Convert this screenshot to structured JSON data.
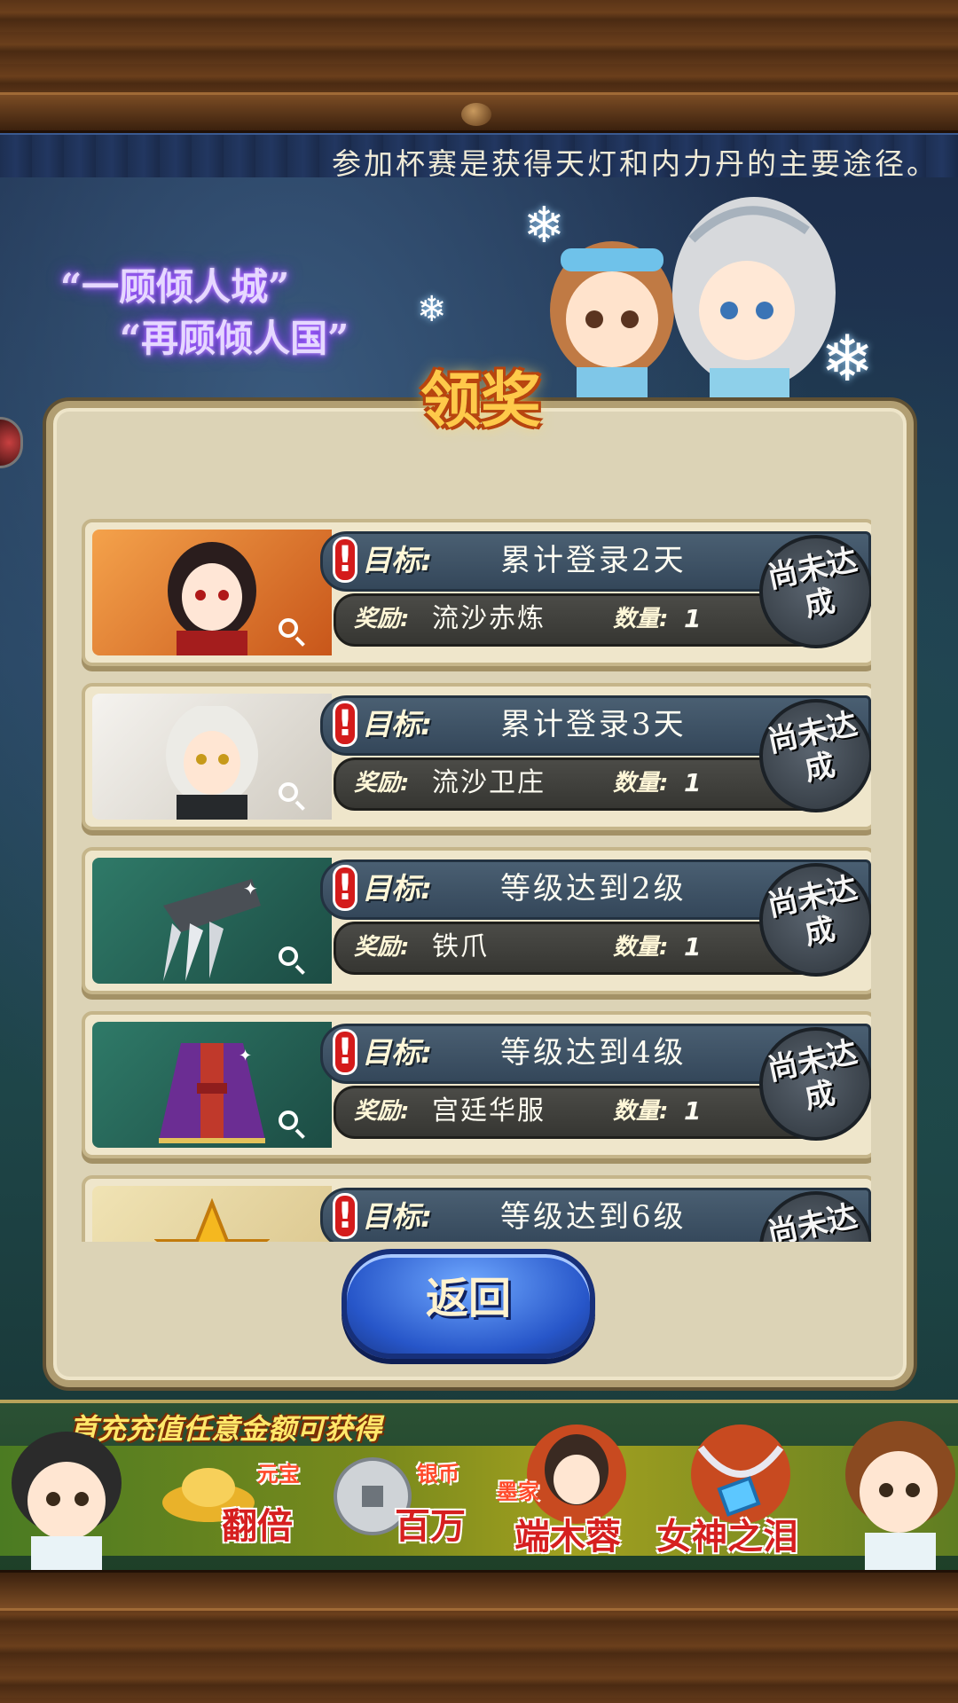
{
  "notice": {
    "text": "参加杯赛是获得天灯和内力丹的主要途径。"
  },
  "slogan": {
    "line1": "“一顾倾人城”",
    "line2": "“再顾倾人国”"
  },
  "panel": {
    "title": "领奖"
  },
  "tasks": [
    {
      "goal_label": "目标:",
      "goal": "累计登录2天",
      "reward_label": "奖励:",
      "reward": "流沙赤炼",
      "qty_label": "数量:",
      "qty": "1",
      "status": "尚未达成",
      "thumb": "character-portrait"
    },
    {
      "goal_label": "目标:",
      "goal": "累计登录3天",
      "reward_label": "奖励:",
      "reward": "流沙卫庄",
      "qty_label": "数量:",
      "qty": "1",
      "status": "尚未达成",
      "thumb": "character-portrait"
    },
    {
      "goal_label": "目标:",
      "goal": "等级达到2级",
      "reward_label": "奖励:",
      "reward": "铁爪",
      "qty_label": "数量:",
      "qty": "1",
      "status": "尚未达成",
      "thumb": "claw-weapon"
    },
    {
      "goal_label": "目标:",
      "goal": "等级达到4级",
      "reward_label": "奖励:",
      "reward": "宫廷华服",
      "qty_label": "数量:",
      "qty": "1",
      "status": "尚未达成",
      "thumb": "robe-armor"
    },
    {
      "goal_label": "目标:",
      "goal": "等级达到6级",
      "status": "尚未达成",
      "thumb": "gold-star"
    }
  ],
  "back_button": {
    "label": "返回"
  },
  "promo": {
    "title": "首充充值任意金额可获得",
    "items": [
      {
        "small": "元宝",
        "big": "翻倍"
      },
      {
        "small": "银币",
        "big": "百万"
      },
      {
        "small": "墨家",
        "big": "端木蓉"
      },
      {
        "small": "",
        "big": "女神之泪"
      }
    ]
  },
  "colors": {
    "accent_gold": "#ffc94a",
    "button_blue": "#2756c9",
    "panel_bg": "#dcd3b6"
  }
}
